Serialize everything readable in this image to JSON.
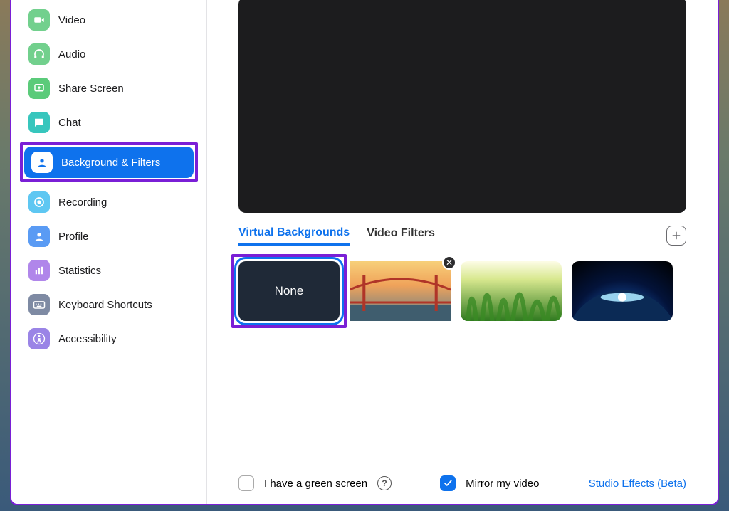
{
  "sidebar": {
    "items": [
      {
        "label": "Video",
        "icon": "video-icon",
        "color": "#72d08d"
      },
      {
        "label": "Audio",
        "icon": "headphones-icon",
        "color": "#72d08d"
      },
      {
        "label": "Share Screen",
        "icon": "share-screen-icon",
        "color": "#5bcb7a"
      },
      {
        "label": "Chat",
        "icon": "chat-icon",
        "color": "#37c6bd"
      },
      {
        "label": "Background & Filters",
        "icon": "person-square-icon",
        "color": "#0e72ed",
        "active": true
      },
      {
        "label": "Recording",
        "icon": "record-icon",
        "color": "#5ec7f2"
      },
      {
        "label": "Profile",
        "icon": "profile-icon",
        "color": "#5a9bf4"
      },
      {
        "label": "Statistics",
        "icon": "stats-icon",
        "color": "#b086ea"
      },
      {
        "label": "Keyboard Shortcuts",
        "icon": "keyboard-icon",
        "color": "#7e8aa3"
      },
      {
        "label": "Accessibility",
        "icon": "accessibility-icon",
        "color": "#9a84e6"
      }
    ]
  },
  "tabs": {
    "virtual_backgrounds": "Virtual Backgrounds",
    "video_filters": "Video Filters"
  },
  "backgrounds": {
    "none_label": "None",
    "items": [
      "none",
      "golden-gate",
      "grass",
      "earth"
    ]
  },
  "footer": {
    "green_screen_label": "I have a green screen",
    "mirror_label": "Mirror my video",
    "studio_effects_label": "Studio Effects (Beta)"
  }
}
